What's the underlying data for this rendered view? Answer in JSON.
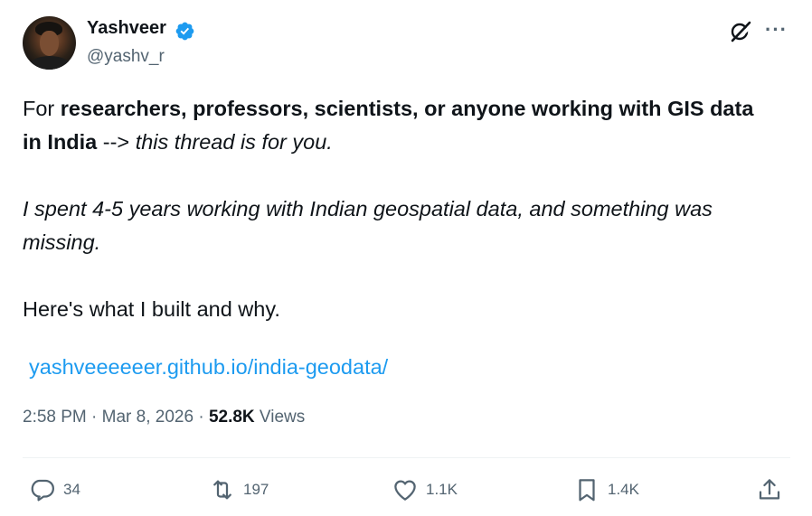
{
  "author": {
    "name": "Yashveer",
    "handle": "@yashv_r",
    "verified": true
  },
  "icons": {
    "verified": "verified-badge-icon",
    "grok": "grok-icon",
    "more": "more-options-icon",
    "reply": "reply-icon",
    "retweet": "retweet-icon",
    "like": "heart-icon",
    "bookmark": "bookmark-icon",
    "share": "share-icon"
  },
  "colors": {
    "verified": "#1d9bf0",
    "link": "#1d9bf0",
    "secondary_text": "#536471",
    "primary_text": "#0f1419"
  },
  "tweet": {
    "line1": {
      "prefix": "For ",
      "bold": "researchers, professors, scientists, or anyone working with GIS data"
    },
    "line2": {
      "bold": "in India",
      "middle": " --> ",
      "italic": "this thread is for you."
    },
    "para2_line1": "I spent 4-5 years working with Indian geospatial data, and something was",
    "para2_line2": "missing.",
    "para3": "Here's what I built and why.",
    "link": "yashveeeeeer.github.io/india-geodata/"
  },
  "meta": {
    "time": "2:58 PM",
    "sep1": " · ",
    "date": "Mar 8, 2026",
    "sep2": " · ",
    "views_count": "52.8K",
    "views_label": " Views"
  },
  "actions": {
    "replies": "34",
    "retweets": "197",
    "likes": "1.1K",
    "bookmarks": "1.4K"
  }
}
